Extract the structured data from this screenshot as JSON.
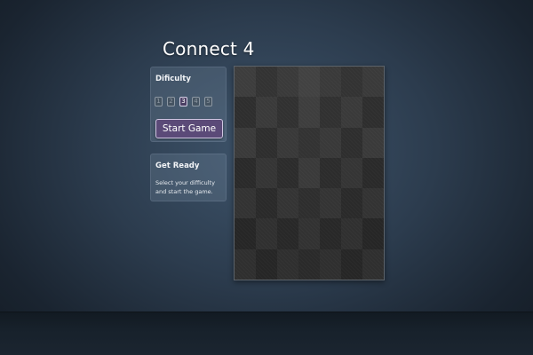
{
  "game": {
    "title": "Connect 4"
  },
  "difficulty_panel": {
    "heading": "Dificulty",
    "levels": [
      "1",
      "2",
      "3",
      "4",
      "5"
    ],
    "selected_level": "3",
    "start_label": "Start Game"
  },
  "status_panel": {
    "heading": "Get Ready",
    "message": "Select your difficulty and start the game."
  },
  "board": {
    "rows": 7,
    "columns": 7,
    "cell_shades": [
      [
        "#3d3d3d",
        "#333333",
        "#3a3a3a",
        "#424242",
        "#3a3a3a",
        "#333333",
        "#3a3a3a"
      ],
      [
        "#2e2e2e",
        "#3a3a3a",
        "#313131",
        "#3e3e3e",
        "#313131",
        "#3a3a3a",
        "#2e2e2e"
      ],
      [
        "#3a3a3a",
        "#2e2e2e",
        "#393939",
        "#333333",
        "#393939",
        "#2e2e2e",
        "#3a3a3a"
      ],
      [
        "#2a2a2a",
        "#353535",
        "#2c2c2c",
        "#3a3a3a",
        "#2c2c2c",
        "#353535",
        "#2a2a2a"
      ],
      [
        "#333333",
        "#2a2a2a",
        "#343434",
        "#2e2e2e",
        "#343434",
        "#2a2a2a",
        "#333333"
      ],
      [
        "#262626",
        "#303030",
        "#282828",
        "#323232",
        "#282828",
        "#303030",
        "#262626"
      ],
      [
        "#2f2f2f",
        "#262626",
        "#2f2f2f",
        "#2a2a2a",
        "#2f2f2f",
        "#262626",
        "#2f2f2f"
      ]
    ]
  }
}
